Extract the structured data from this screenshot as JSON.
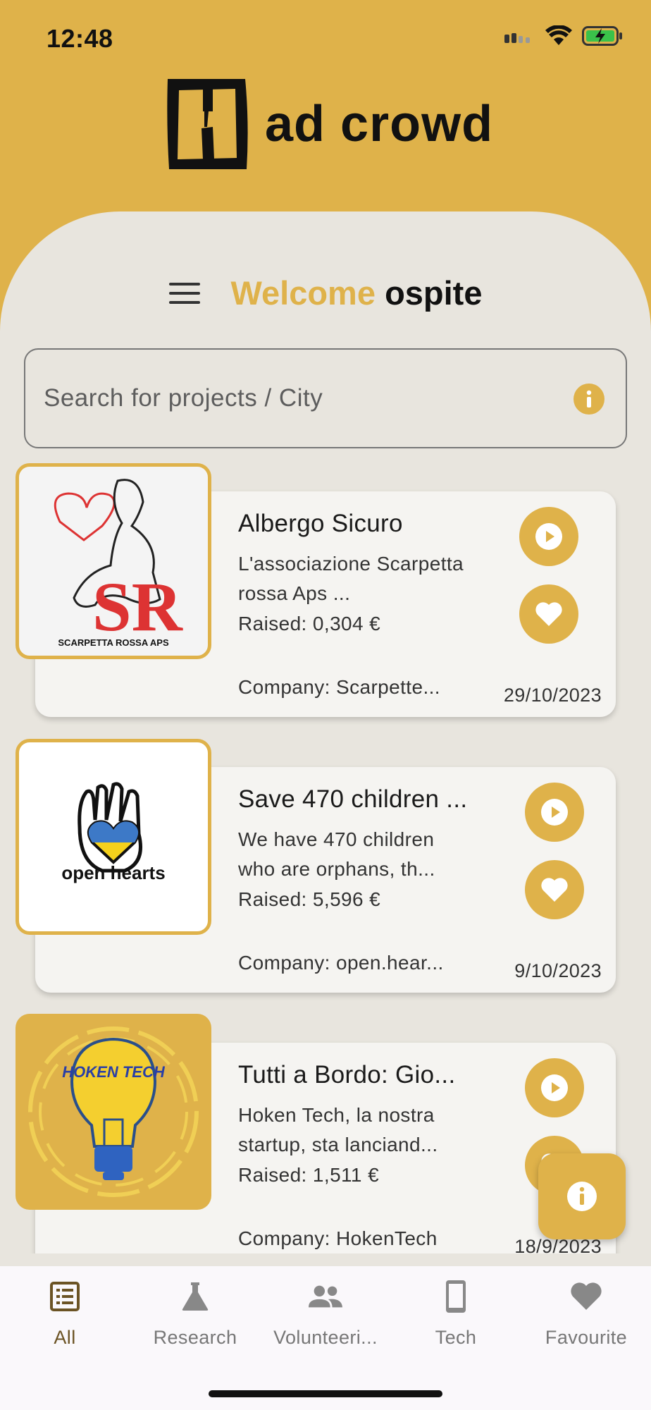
{
  "status_bar": {
    "time": "12:48"
  },
  "brand": {
    "logo_text": "ad crowd"
  },
  "header": {
    "welcome_word": "Welcome",
    "user_name": "ospite"
  },
  "search": {
    "placeholder": "Search for projects / City"
  },
  "projects": [
    {
      "title": "Albergo Sicuro",
      "description": "L'associazione Scarpetta rossa Aps ...",
      "raised": "Raised: 0,304 €",
      "company": "Company: Scarpette...",
      "date": "29/10/2023",
      "logo_text": "SCARPETTA ROSSA APS"
    },
    {
      "title": "Save 470 children ...",
      "description": "We have 470 children who are orphans, th...",
      "raised": "Raised: 5,596 €",
      "company": "Company: open.hear...",
      "date": "9/10/2023",
      "logo_text": "open hearts"
    },
    {
      "title": "Tutti a Bordo: Gio...",
      "description": "Hoken Tech, la nostra startup, sta lanciand...",
      "raised": "Raised: 1,511 €",
      "company": "Company: HokenTech",
      "date": "18/9/2023",
      "logo_text": "HOKEN TECH"
    }
  ],
  "nav": [
    {
      "label": "All",
      "icon": "list-icon",
      "active": true
    },
    {
      "label": "Research",
      "icon": "flask-icon"
    },
    {
      "label": "Volunteeri...",
      "icon": "people-icon"
    },
    {
      "label": "Tech",
      "icon": "phone-icon"
    },
    {
      "label": "Favourite",
      "icon": "heart-icon"
    }
  ],
  "colors": {
    "accent": "#dfb24a",
    "sheet": "#e8e5de",
    "card": "#f5f4f1",
    "nav_bg": "#faf8fb",
    "active_nav": "#6b5324"
  }
}
